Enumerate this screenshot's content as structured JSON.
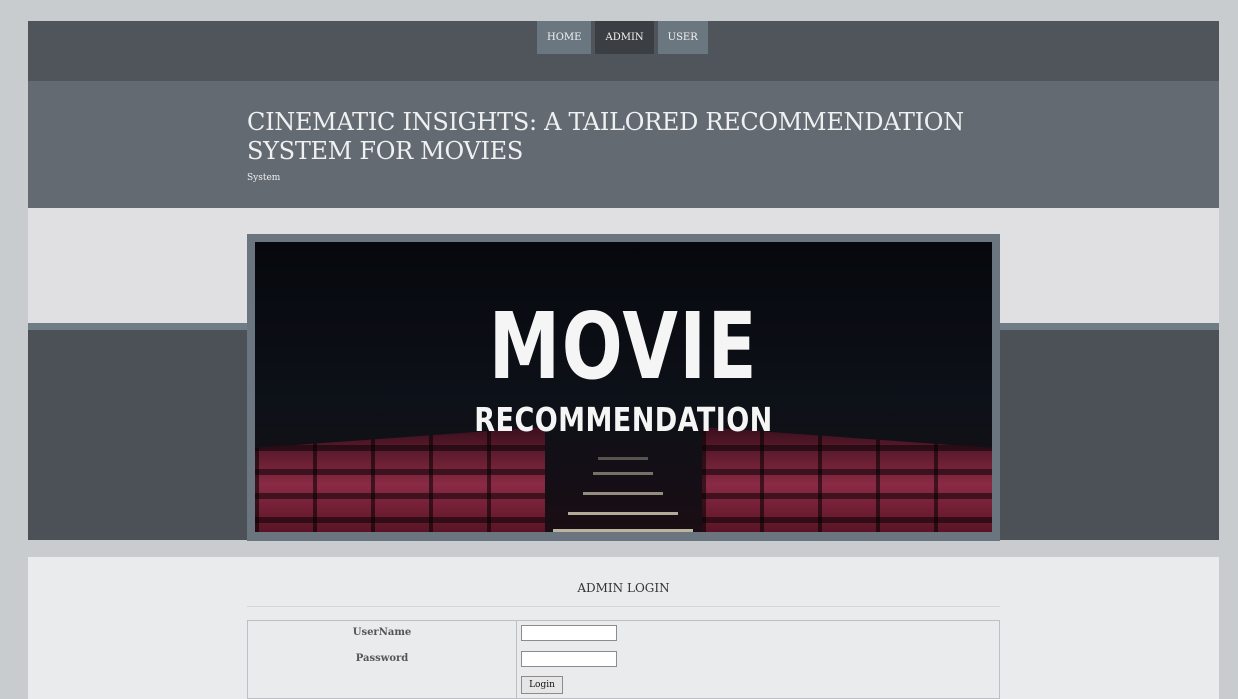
{
  "nav": {
    "items": [
      {
        "label": "HOME",
        "active": false
      },
      {
        "label": "ADMIN",
        "active": true
      },
      {
        "label": "USER",
        "active": false
      }
    ]
  },
  "header": {
    "title": "CINEMATIC INSIGHTS: A TAILORED RECOMMENDATION SYSTEM FOR MOVIES",
    "subtitle": "System"
  },
  "banner": {
    "line1": "MOVIE",
    "line2": "RECOMMENDATION"
  },
  "login": {
    "title": "ADMIN LOGIN",
    "username_label": "UserName",
    "password_label": "Password",
    "username_value": "",
    "password_value": "",
    "button_label": "Login"
  },
  "colors": {
    "page_bg": "#c9ccce",
    "nav_bg": "#4f555b",
    "nav_item": "#6b7780",
    "nav_item_active": "#3b3f43",
    "header_bg": "#646a71",
    "content_bg": "#eaebec"
  }
}
